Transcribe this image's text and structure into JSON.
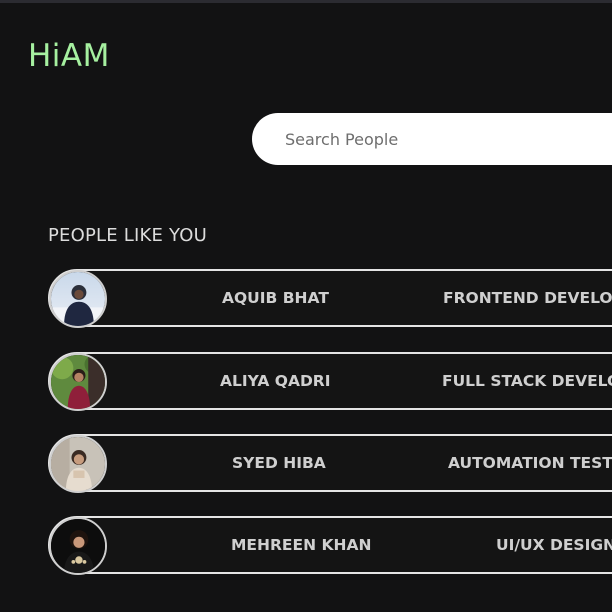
{
  "app": {
    "logo": "HiAM"
  },
  "search": {
    "placeholder": "Search People"
  },
  "section": {
    "title": "PEOPLE LIKE YOU"
  },
  "people": [
    {
      "name": "AQUIB BHAT",
      "role": "FRONTEND DEVELO",
      "avatar": "avatar-photo"
    },
    {
      "name": "ALIYA QADRI",
      "role": "FULL STACK DEVELO",
      "avatar": "avatar-photo"
    },
    {
      "name": "SYED HIBA",
      "role": "AUTOMATION TESTI",
      "avatar": "avatar-photo"
    },
    {
      "name": "MEHREEN KHAN",
      "role": "UI/UX DESIGN",
      "avatar": "avatar-photo"
    }
  ],
  "colors": {
    "background": "#121213",
    "logo": "#a6f0a0",
    "row_border": "#e4e4e4",
    "text": "#cfcfcf",
    "search_bg": "#ffffff"
  }
}
